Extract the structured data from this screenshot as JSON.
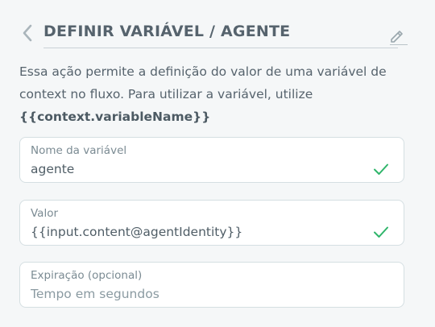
{
  "header": {
    "title": "DEFINIR VARIÁVEL / AGENTE",
    "back_icon": "chevron-left-icon",
    "edit_icon": "pencil-icon"
  },
  "description": {
    "text": "Essa ação permite a definição do valor de uma variável de context no fluxo. Para utilizar a variável, utilize",
    "code": "{{context.variableName}}"
  },
  "fields": {
    "name": {
      "label": "Nome da variável",
      "value": "agente",
      "status": "valid"
    },
    "value": {
      "label": "Valor",
      "value": "{{input.content@agentIdentity}}",
      "status": "valid"
    },
    "expiration": {
      "label": "Expiração (opcional)",
      "value": "",
      "placeholder": "Tempo em segundos"
    }
  },
  "colors": {
    "check": "#2fb56a",
    "text": "#56636d",
    "border": "#d5dfe2",
    "background": "#f5f7f8"
  }
}
